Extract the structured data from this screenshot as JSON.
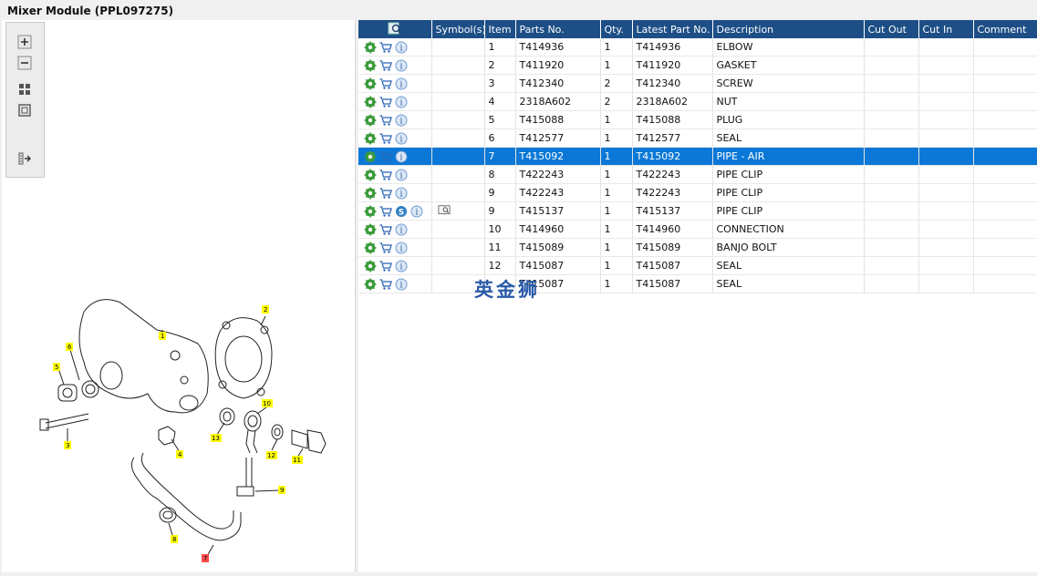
{
  "header": {
    "title": "Mixer Module (PPL097275)"
  },
  "toolbar": {
    "zoom_in_icon": "plus-icon",
    "zoom_out_icon": "minus-icon",
    "fit_icon": "grid-icon",
    "actual_icon": "square-icon",
    "export_icon": "export-icon"
  },
  "table": {
    "columns": [
      "",
      "Symbol(s)",
      "Item",
      "Parts No.",
      "Qty.",
      "Latest Part No.",
      "Description",
      "Cut Out",
      "Cut In",
      "Comment"
    ],
    "rows": [
      {
        "item": "1",
        "part": "T414936",
        "qty": "1",
        "latest": "T414936",
        "desc": "ELBOW"
      },
      {
        "item": "2",
        "part": "T411920",
        "qty": "1",
        "latest": "T411920",
        "desc": "GASKET"
      },
      {
        "item": "3",
        "part": "T412340",
        "qty": "2",
        "latest": "T412340",
        "desc": "SCREW"
      },
      {
        "item": "4",
        "part": "2318A602",
        "qty": "2",
        "latest": "2318A602",
        "desc": "NUT"
      },
      {
        "item": "5",
        "part": "T415088",
        "qty": "1",
        "latest": "T415088",
        "desc": "PLUG"
      },
      {
        "item": "6",
        "part": "T412577",
        "qty": "1",
        "latest": "T412577",
        "desc": "SEAL"
      },
      {
        "item": "7",
        "part": "T415092",
        "qty": "1",
        "latest": "T415092",
        "desc": "PIPE - AIR",
        "selected": true
      },
      {
        "item": "8",
        "part": "T422243",
        "qty": "1",
        "latest": "T422243",
        "desc": "PIPE CLIP"
      },
      {
        "item": "9",
        "part": "T422243",
        "qty": "1",
        "latest": "T422243",
        "desc": "PIPE CLIP"
      },
      {
        "item": "9",
        "part": "T415137",
        "qty": "1",
        "latest": "T415137",
        "desc": "PIPE CLIP",
        "special": true
      },
      {
        "item": "10",
        "part": "T414960",
        "qty": "1",
        "latest": "T414960",
        "desc": "CONNECTION"
      },
      {
        "item": "11",
        "part": "T415089",
        "qty": "1",
        "latest": "T415089",
        "desc": "BANJO BOLT"
      },
      {
        "item": "12",
        "part": "T415087",
        "qty": "1",
        "latest": "T415087",
        "desc": "SEAL"
      },
      {
        "item": "",
        "part": "T415087",
        "qty": "1",
        "latest": "T415087",
        "desc": "SEAL"
      }
    ]
  },
  "watermark": "英金狮",
  "diagram": {
    "callouts": [
      "1",
      "2",
      "3",
      "4",
      "5",
      "6",
      "7",
      "8",
      "9",
      "10",
      "11",
      "12",
      "13"
    ]
  },
  "colors": {
    "header_bg": "#1d4f86",
    "selected_row": "#0b78d7",
    "callout_bg": "#ffff00",
    "selected_callout": "#ff4d4d"
  }
}
